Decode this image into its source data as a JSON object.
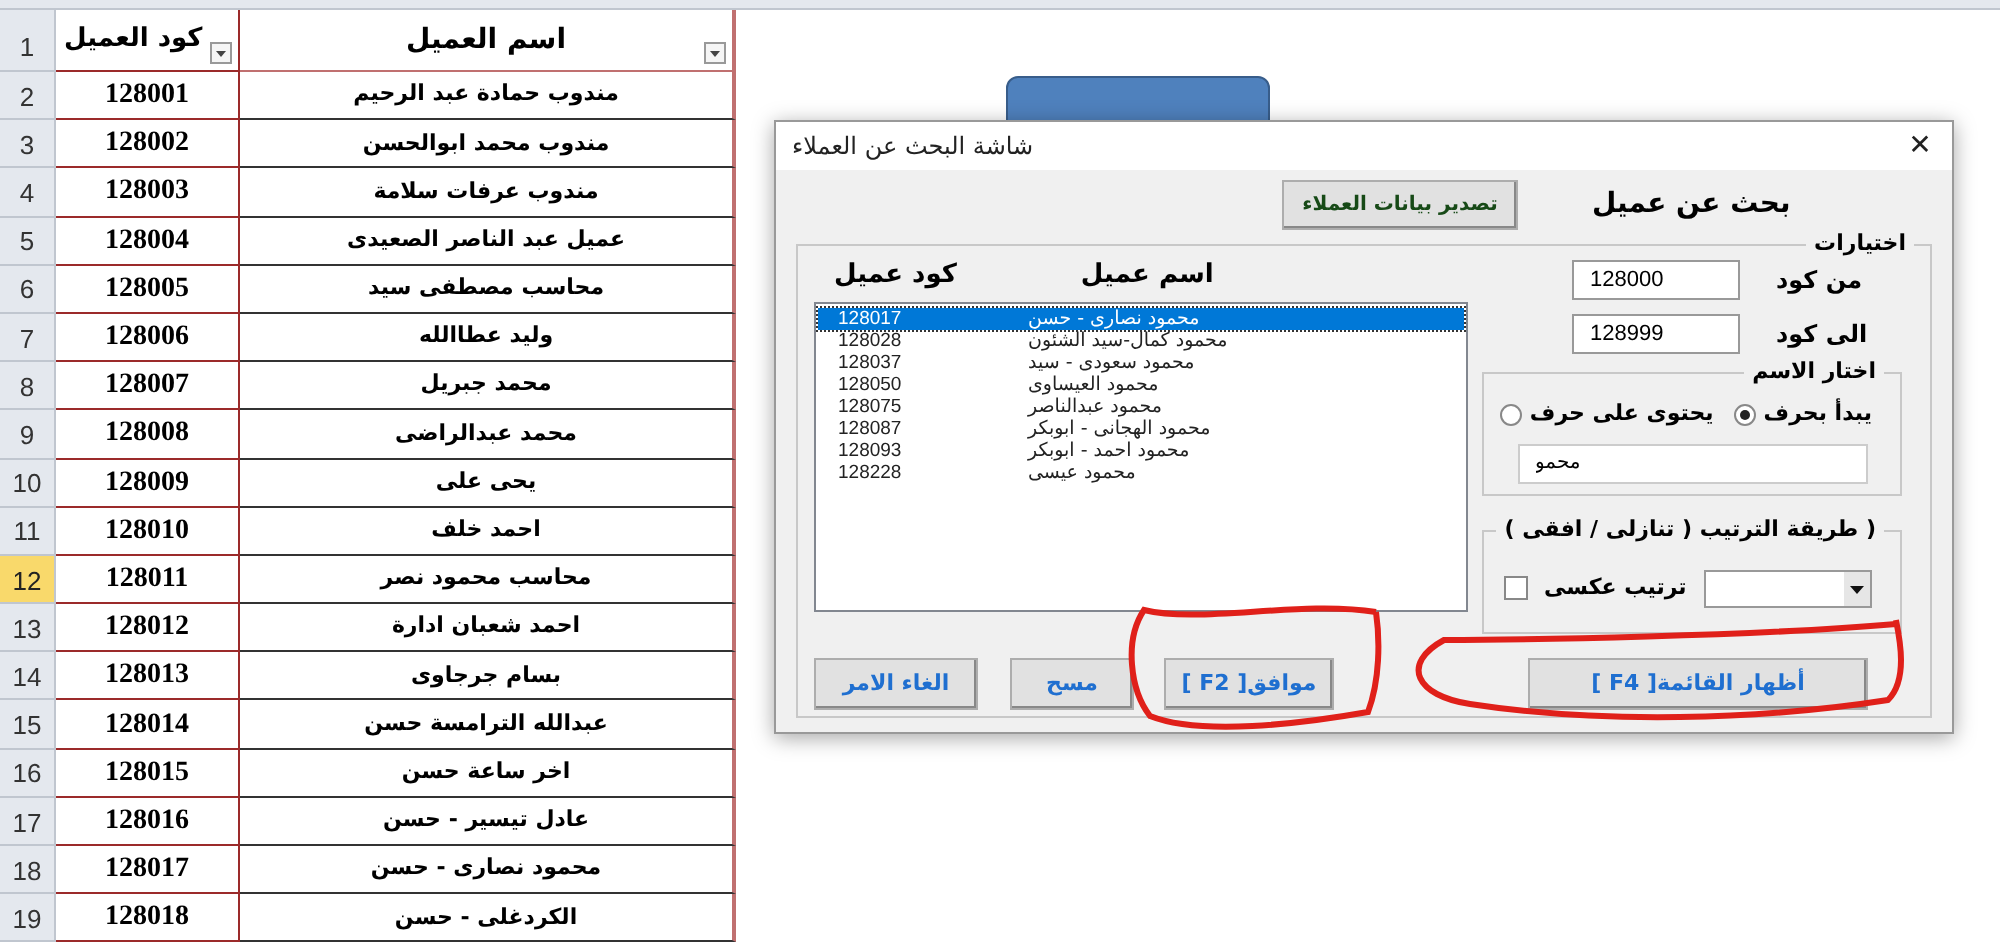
{
  "sheet": {
    "header_row_number": "1",
    "headers": {
      "code": "كود العميل",
      "name": "اسم العميل"
    },
    "rows": [
      {
        "row_number": "2",
        "code": "128001",
        "name": "مندوب حمادة عبد الرحيم",
        "selected": false
      },
      {
        "row_number": "3",
        "code": "128002",
        "name": "مندوب محمد ابوالحسن",
        "selected": false
      },
      {
        "row_number": "4",
        "code": "128003",
        "name": "مندوب عرفات سلامة",
        "selected": false
      },
      {
        "row_number": "5",
        "code": "128004",
        "name": "عميل عبد الناصر الصعيدى",
        "selected": false
      },
      {
        "row_number": "6",
        "code": "128005",
        "name": "محاسب مصطفى سيد",
        "selected": false
      },
      {
        "row_number": "7",
        "code": "128006",
        "name": "وليد عطاالله",
        "selected": false
      },
      {
        "row_number": "8",
        "code": "128007",
        "name": "محمد جبريل",
        "selected": false
      },
      {
        "row_number": "9",
        "code": "128008",
        "name": "محمد عبدالراضى",
        "selected": false
      },
      {
        "row_number": "10",
        "code": "128009",
        "name": "يحى على",
        "selected": false
      },
      {
        "row_number": "11",
        "code": "128010",
        "name": "احمد خلف",
        "selected": false
      },
      {
        "row_number": "12",
        "code": "128011",
        "name": "محاسب محمود نصر",
        "selected": true
      },
      {
        "row_number": "13",
        "code": "128012",
        "name": "احمد شعبان ادارة",
        "selected": false
      },
      {
        "row_number": "14",
        "code": "128013",
        "name": "بسام جرجاوى",
        "selected": false
      },
      {
        "row_number": "15",
        "code": "128014",
        "name": "عبدالله الترامسة حسن",
        "selected": false
      },
      {
        "row_number": "16",
        "code": "128015",
        "name": "اخر ساعة حسن",
        "selected": false
      },
      {
        "row_number": "17",
        "code": "128016",
        "name": "عادل تيسير  - حسن",
        "selected": false
      },
      {
        "row_number": "18",
        "code": "128017",
        "name": "محمود نصارى - حسن",
        "selected": false
      },
      {
        "row_number": "19",
        "code": "128018",
        "name": "الكردغلى - حسن",
        "selected": false
      }
    ]
  },
  "dialog": {
    "title": "شاشة البحث عن العملاء",
    "close": "✕",
    "heading": "بحث عن عميل",
    "export_button": "تصدير بيانات العملاء",
    "options_group": {
      "title": "اختيارات",
      "list_headers": {
        "name": "اسم عميل",
        "code": "كود عميل"
      },
      "list_items": [
        {
          "code": "128017",
          "name": "محمود نصارى - حسن",
          "selected": true
        },
        {
          "code": "128028",
          "name": "محمود كمال-سيد الشئون",
          "selected": false
        },
        {
          "code": "128037",
          "name": "محمود سعودى - سيد",
          "selected": false
        },
        {
          "code": "128050",
          "name": "محمود العيساوى",
          "selected": false
        },
        {
          "code": "128075",
          "name": "محمود عبدالناصر",
          "selected": false
        },
        {
          "code": "128087",
          "name": "محمود الهجانى - ابوبكر",
          "selected": false
        },
        {
          "code": "128093",
          "name": "محمود احمد - ابوبكر",
          "selected": false
        },
        {
          "code": "128228",
          "name": "محمود عيسى",
          "selected": false
        }
      ],
      "from_code": {
        "label": "من كود",
        "value": "128000"
      },
      "to_code": {
        "label": "الى كود",
        "value": "128999"
      },
      "name_group": {
        "title": "اختار الاسم",
        "options": [
          {
            "label": "يبدأ بحرف",
            "selected": true
          },
          {
            "label": "يحتوى على حرف",
            "selected": false
          }
        ],
        "value": "محمو"
      },
      "sort_group": {
        "title": "( طريقة الترتيب ( تنازلى / افقى )",
        "reverse_label": "ترتيب عكسى",
        "reverse_checked": false
      }
    },
    "buttons": [
      {
        "label": "أظهار القائمة[ F4 ]"
      },
      {
        "label": "موافق[ F2 ]"
      },
      {
        "label": "مسح"
      },
      {
        "label": "الغاء الامر"
      }
    ]
  }
}
